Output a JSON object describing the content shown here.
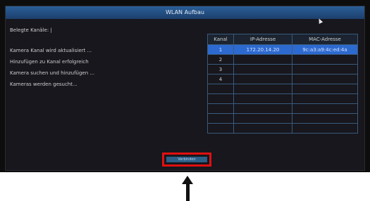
{
  "window": {
    "title": "WLAN Aufbau"
  },
  "status": {
    "occupied_channels": "Belegte Kanäle: |",
    "log": [
      "Kamera Kanal wird aktualisiert ...",
      "Hinzufügen zu Kanal erfolgreich",
      "Kamera suchen und hinzufügen ...",
      "Kameras werden gesucht..."
    ]
  },
  "table": {
    "headers": [
      "Kanal",
      "IP-Adresse",
      "MAC-Adresse"
    ],
    "rows": [
      [
        "1",
        "172.20.14.20",
        "9c:a3:a9:4c:ed:4a"
      ],
      [
        "2",
        "",
        ""
      ],
      [
        "3",
        "",
        ""
      ],
      [
        "4",
        "",
        ""
      ],
      [
        "",
        "",
        ""
      ],
      [
        "",
        "",
        ""
      ],
      [
        "",
        "",
        ""
      ],
      [
        "",
        "",
        ""
      ],
      [
        "",
        "",
        ""
      ]
    ],
    "selected_row": 0
  },
  "footer": {
    "button_label": "Verbinden"
  },
  "colors": {
    "highlight": "#e01010",
    "selection": "#2d6ad0"
  }
}
